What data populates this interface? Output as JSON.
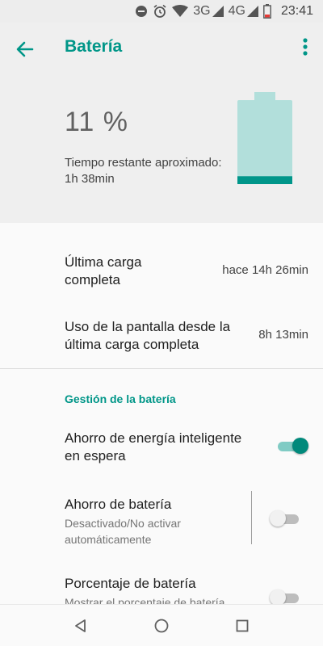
{
  "status_bar": {
    "network_3g": "3G",
    "network_4g": "4G",
    "time": "23:41",
    "icons": [
      "do-not-disturb-icon",
      "alarm-icon",
      "wifi-icon",
      "signal-icon",
      "signal-icon",
      "battery-low-icon"
    ]
  },
  "app_bar": {
    "title": "Batería",
    "back_icon": "arrow-back-icon",
    "more_icon": "more-vert-icon"
  },
  "battery": {
    "percent_label": "11 %",
    "level": 0.11,
    "remaining_label": "Tiempo restante aproximado:",
    "remaining_value": "1h 38min"
  },
  "stats": [
    {
      "title_line1": "Última carga",
      "title_line2": "completa",
      "value": "hace 14h 26min"
    },
    {
      "title_line1": "Uso de la pantalla desde la",
      "title_line2": "última carga completa",
      "value": "8h 13min"
    }
  ],
  "management": {
    "header": "Gestión de la batería",
    "items": [
      {
        "title_line1": "Ahorro de energía inteligente",
        "title_line2": "en espera",
        "enabled": true
      },
      {
        "title_line1": "Ahorro de batería",
        "subtitle_line1": "Desactivado/No activar",
        "subtitle_line2": "automáticamente",
        "enabled": false
      },
      {
        "title_line1": "Porcentaje de batería",
        "subtitle_line1": "Mostrar el porcentaje de batería",
        "enabled": false
      }
    ]
  },
  "colors": {
    "accent": "#009688",
    "battery_fill": "#00968a",
    "battery_body": "#b2dfdb",
    "header_bg": "#efefef"
  },
  "nav_bar": [
    "back-triangle-icon",
    "home-circle-icon",
    "recents-square-icon"
  ]
}
